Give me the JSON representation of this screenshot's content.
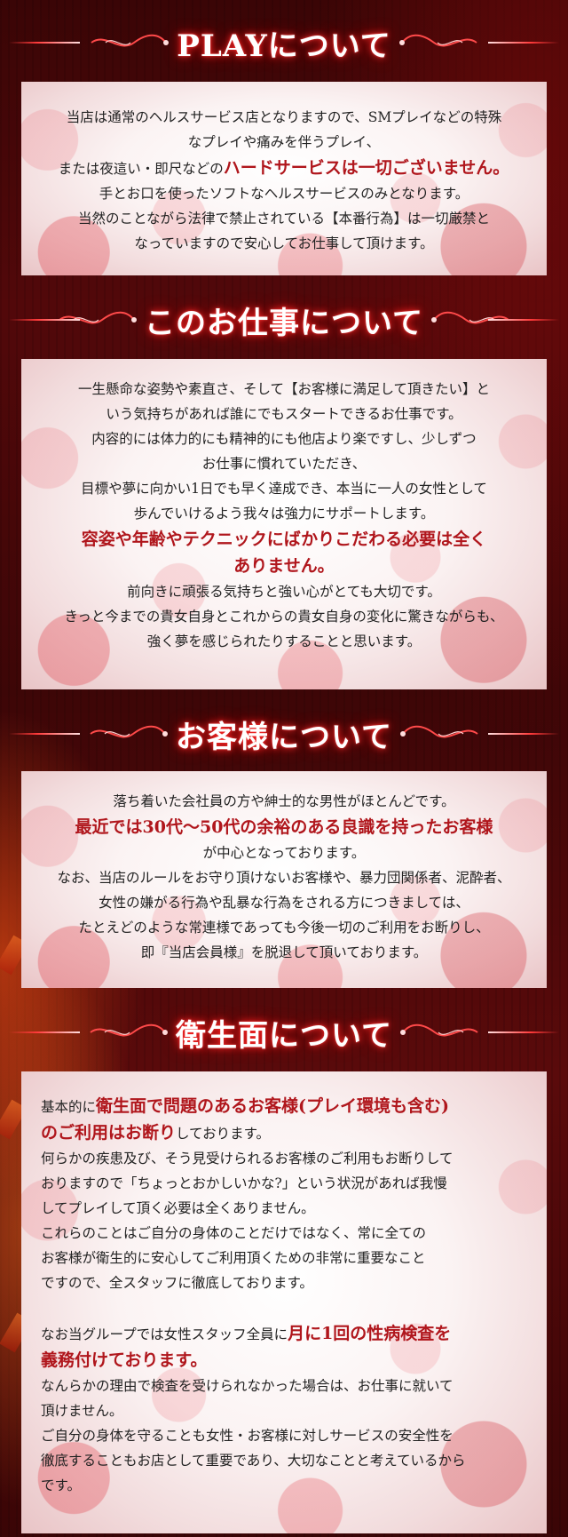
{
  "sections": [
    {
      "title": "PLAYについて",
      "lines": [
        {
          "text": "当店は通常のヘルスサービス店となりますので、SMプレイなどの特殊"
        },
        {
          "text": "なプレイや痛みを伴うプレイ、"
        },
        {
          "pre": "または夜這い・即尺などの",
          "hl": "ハードサービスは一切ございません。"
        },
        {
          "text": "手とお口を使ったソフトなヘルスサービスのみとなります。"
        },
        {
          "text": "当然のことながら法律で禁止されている【本番行為】は一切厳禁と"
        },
        {
          "text": "なっていますので安心してお仕事して頂けます。"
        }
      ]
    },
    {
      "title": "このお仕事について",
      "lines": [
        {
          "text": "一生懸命な姿勢や素直さ、そして【お客様に満足して頂きたい】と"
        },
        {
          "text": "いう気持ちがあれば誰にでもスタートできるお仕事です。"
        },
        {
          "text": "内容的には体力的にも精神的にも他店より楽ですし、少しずつ"
        },
        {
          "text": "お仕事に慣れていただき、"
        },
        {
          "text": "目標や夢に向かい1日でも早く達成でき、本当に一人の女性として"
        },
        {
          "text": "歩んでいけるよう我々は強力にサポートします。"
        },
        {
          "hl": "容姿や年齢やテクニックにばかりこだわる必要は全く"
        },
        {
          "hl": "ありません。"
        },
        {
          "text": "前向きに頑張る気持ちと強い心がとても大切です。"
        },
        {
          "text": "きっと今までの貴女自身とこれからの貴女自身の変化に驚きながらも、"
        },
        {
          "text": "強く夢を感じられたりすることと思います。"
        }
      ]
    },
    {
      "title": "お客様について",
      "lines": [
        {
          "text": "落ち着いた会社員の方や紳士的な男性がほとんどです。"
        },
        {
          "hl": "最近では30代～50代の余裕のある良識を持ったお客様"
        },
        {
          "text": "が中心となっております。"
        },
        {
          "text": "なお、当店のルールをお守り頂けないお客様や、暴力団関係者、泥酔者、"
        },
        {
          "text": "女性の嫌がる行為や乱暴な行為をされる方につきましては、"
        },
        {
          "text": "たとえどのような常連様であっても今後一切のご利用をお断りし、"
        },
        {
          "text": "即『当店会員様』を脱退して頂いております。"
        }
      ]
    },
    {
      "title": "衛生面について",
      "lines": [
        {
          "pre": "基本的に",
          "hl": "衛生面で問題のあるお客様(プレイ環境も含む)"
        },
        {
          "hl": "のご利用はお断り",
          "post": "しております。"
        },
        {
          "text": "何らかの疾患及び、そう見受けられるお客様のご利用もお断りして"
        },
        {
          "text": "おりますので「ちょっとおかしいかな?」という状況があれば我慢"
        },
        {
          "text": "してプレイして頂く必要は全くありません。"
        },
        {
          "text": "これらのことはご自分の身体のことだけではなく、常に全ての"
        },
        {
          "text": "お客様が衛生的に安心してご利用頂くための非常に重要なこと"
        },
        {
          "text": "ですので、全スタッフに徹底しております。"
        },
        {
          "gap": true
        },
        {
          "pre": "なお当グループでは女性スタッフ全員に",
          "hl": "月に1回の性病検査を"
        },
        {
          "hl": "義務付けております。"
        },
        {
          "text": "なんらかの理由で検査を受けられなかった場合は、お仕事に就いて"
        },
        {
          "text": "頂けません。"
        },
        {
          "text": "ご自分の身体を守ることも女性・お客様に対しサービスの安全性を"
        },
        {
          "text": "徹底することもお店として重要であり、大切なことと考えているから"
        },
        {
          "text": "です。"
        }
      ]
    }
  ],
  "colors": {
    "highlight": "#b0161c",
    "title_glow": "#ff2a2a",
    "body_text": "#222222"
  }
}
